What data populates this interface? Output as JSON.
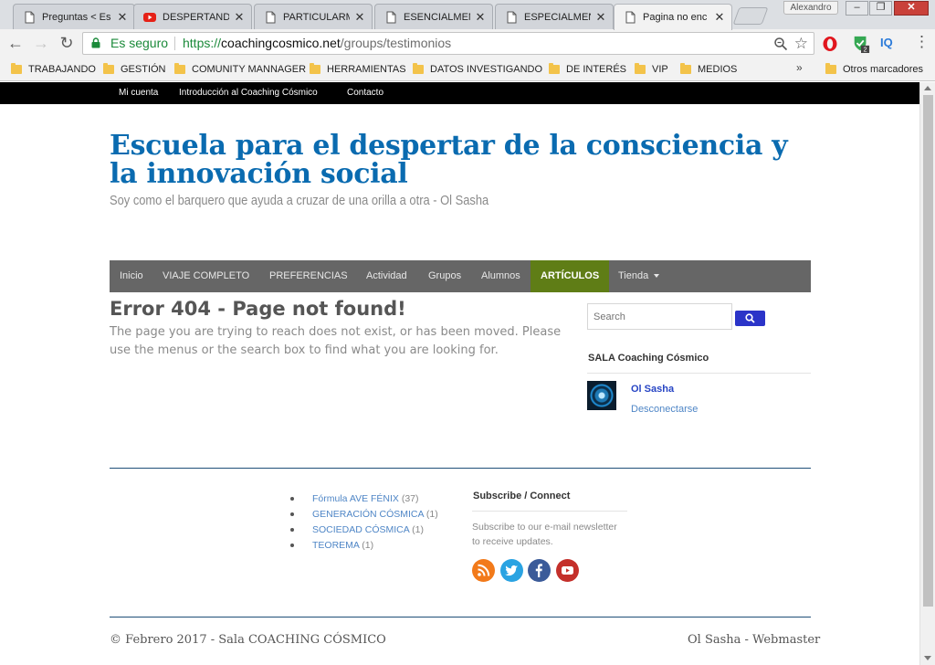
{
  "browser": {
    "tabs": [
      {
        "title": "Preguntas < Es",
        "icon": "page-icon"
      },
      {
        "title": "DESPERTANDO",
        "icon": "youtube-icon"
      },
      {
        "title": "PARTICULARM",
        "icon": "page-icon"
      },
      {
        "title": "ESENCIALMEN",
        "icon": "page-icon"
      },
      {
        "title": "ESPECIALMEN",
        "icon": "page-icon"
      },
      {
        "title": "Pagina no enc",
        "icon": "page-icon",
        "active": true
      }
    ],
    "profile_name": "Alexandro",
    "secure_label": "Es seguro",
    "url": {
      "scheme": "https://",
      "domain": "coachingcosmico.net",
      "path": "/groups/testimonios"
    },
    "bookmarks": [
      "TRABAJANDO",
      "GESTIÓN",
      "COMUNITY MANNAGER",
      "HERRAMIENTAS",
      "DATOS INVESTIGANDO",
      "DE INTERÉS",
      "VIP",
      "MEDIOS"
    ],
    "bookmarks_more": "»",
    "other_bookmarks": "Otros marcadores",
    "extension_badge": "2",
    "iq_label": "IQ"
  },
  "site": {
    "top_links": [
      "Mi cuenta",
      "Introducción al Coaching Cósmico",
      "Contacto"
    ],
    "title": "Escuela para el despertar de la consciencia y la innovación social",
    "tagline": "Soy como el barquero que ayuda a cruzar de una orilla a otra - Ol Sasha",
    "nav": [
      "Inicio",
      "VIAJE COMPLETO",
      "PREFERENCIAS",
      "Actividad",
      "Grupos",
      "Alumnos",
      "ARTÍCULOS",
      "Tienda"
    ],
    "nav_active": "ARTÍCULOS"
  },
  "error": {
    "title": "Error 404 - Page not found!",
    "message": "The page you are trying to reach does not exist, or has been moved. Please use the menus or the search box to find what you are looking for."
  },
  "sidebar": {
    "search_placeholder": "Search",
    "heading": "SALA Coaching Cósmico",
    "user_name": "Ol Sasha",
    "logout_label": "Desconectarse"
  },
  "footer_widgets": {
    "categories": [
      {
        "name": "Fórmula AVE FÉNIX",
        "count": "(37)"
      },
      {
        "name": "GENERACIÓN CÓSMICA",
        "count": "(1)"
      },
      {
        "name": "SOCIEDAD CÓSMICA",
        "count": "(1)"
      },
      {
        "name": "TEOREMA",
        "count": "(1)"
      }
    ],
    "subscribe_heading": "Subscribe / Connect",
    "subscribe_text": "Subscribe to our e-mail newsletter to receive updates.",
    "social": [
      "rss-icon",
      "twitter-icon",
      "facebook-icon",
      "youtube-icon"
    ]
  },
  "footer": {
    "left": "© Febrero 2017 - Sala COACHING CÓSMICO",
    "right": "Ol Sasha - Webmaster"
  },
  "colors": {
    "title_blue": "#0a6bb0",
    "nav_bg": "#666666",
    "nav_active": "#5f7d16",
    "search_button": "#2b34c8",
    "secure_green": "#1b8a3a"
  }
}
